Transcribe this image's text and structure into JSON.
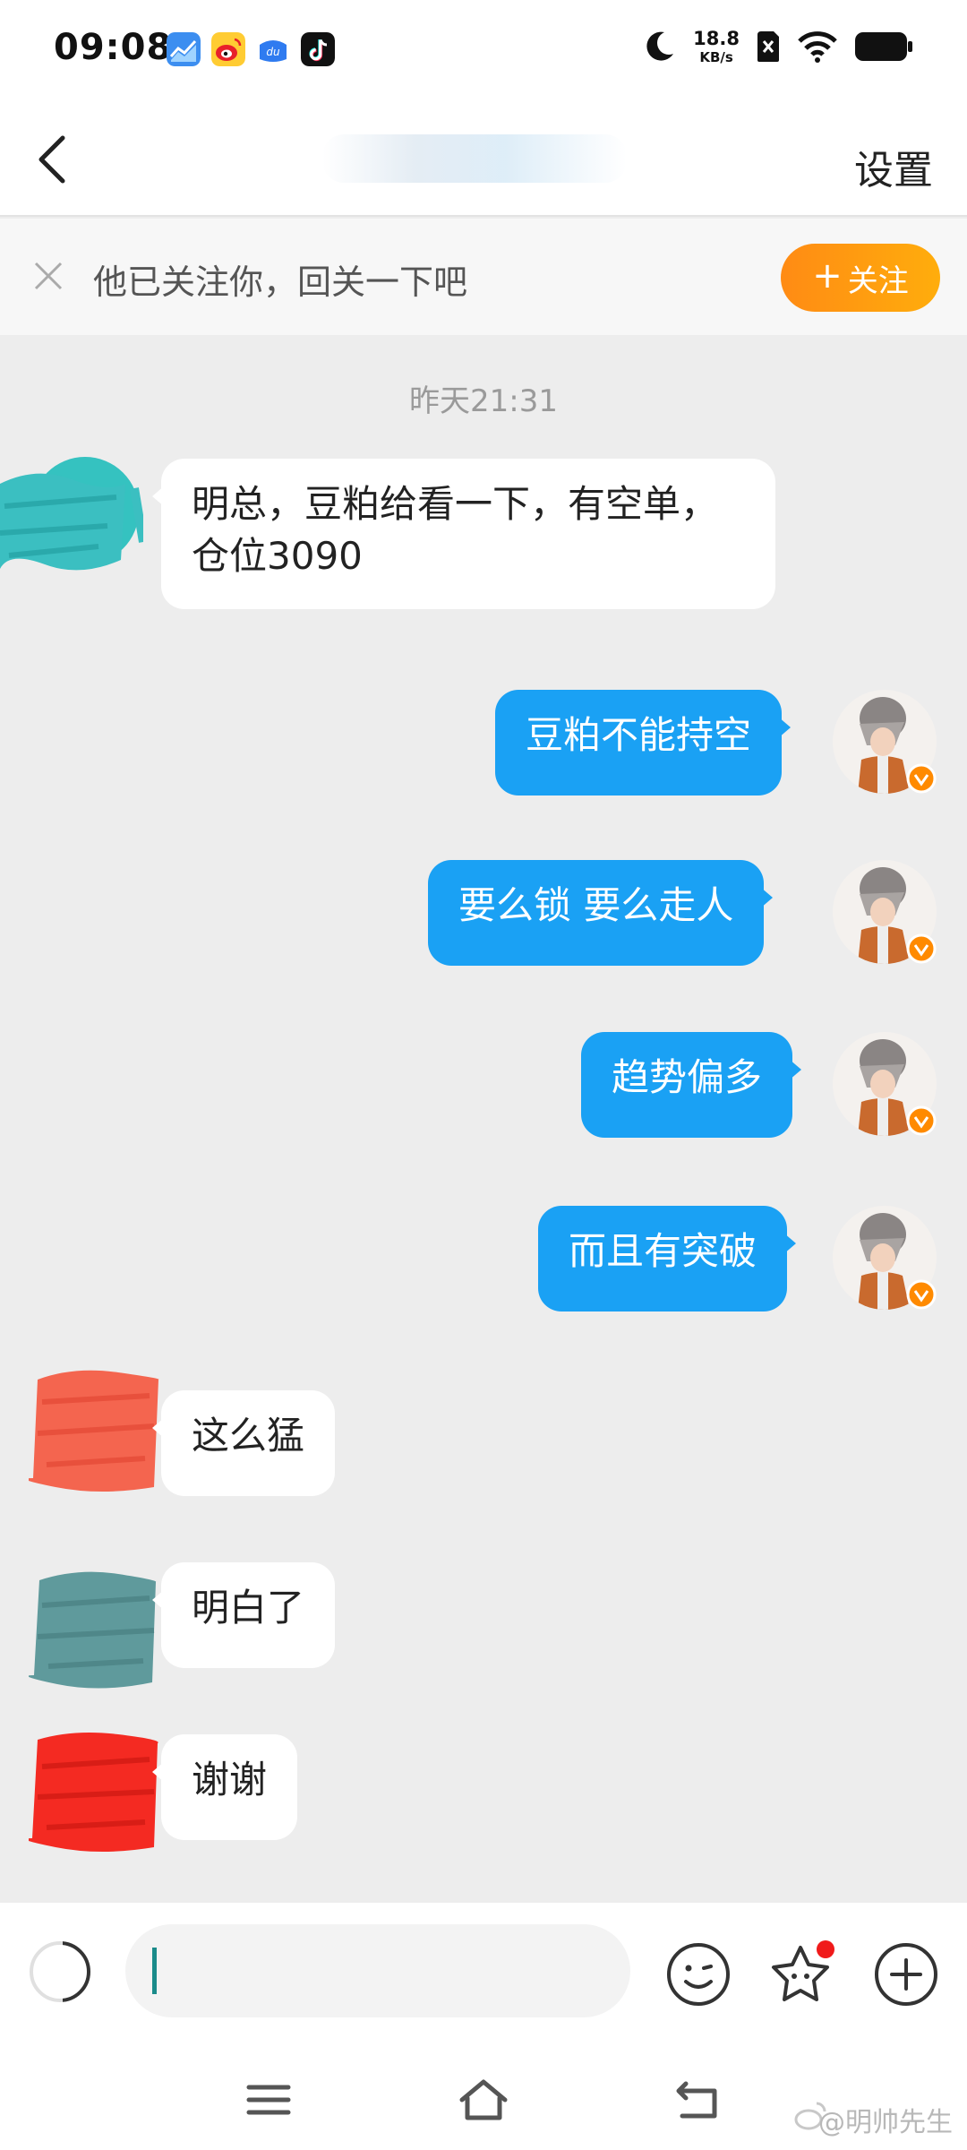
{
  "status_bar": {
    "time": "09:08",
    "net_speed_value": "18.8",
    "net_speed_unit": "KB/s",
    "app_icons": [
      "stock-app-icon",
      "weibo-app-icon",
      "baidu-app-icon",
      "tiktok-app-icon"
    ]
  },
  "nav": {
    "settings_label": "设置"
  },
  "follow_banner": {
    "message": "他已关注你，回关一下吧",
    "follow_button_label": "关注"
  },
  "chat": {
    "timestamp": "昨天21:31",
    "messages": [
      {
        "side": "in",
        "text": "明总，豆粕给看一下，有空单，\n仓位3090"
      },
      {
        "side": "out",
        "text": "豆粕不能持空"
      },
      {
        "side": "out",
        "text": "要么锁  要么走人"
      },
      {
        "side": "out",
        "text": "趋势偏多"
      },
      {
        "side": "out",
        "text": "而且有突破"
      },
      {
        "side": "in",
        "text": "这么猛"
      },
      {
        "side": "in",
        "text": "明白了"
      },
      {
        "side": "in",
        "text": "谢谢"
      }
    ]
  },
  "watermark": "@明帅先生",
  "colors": {
    "outgoing_bubble": "#1aa1f4",
    "follow_button": "#ff9a10",
    "notification_dot": "#f01a1a",
    "verified_badge": "#ff8a00"
  }
}
